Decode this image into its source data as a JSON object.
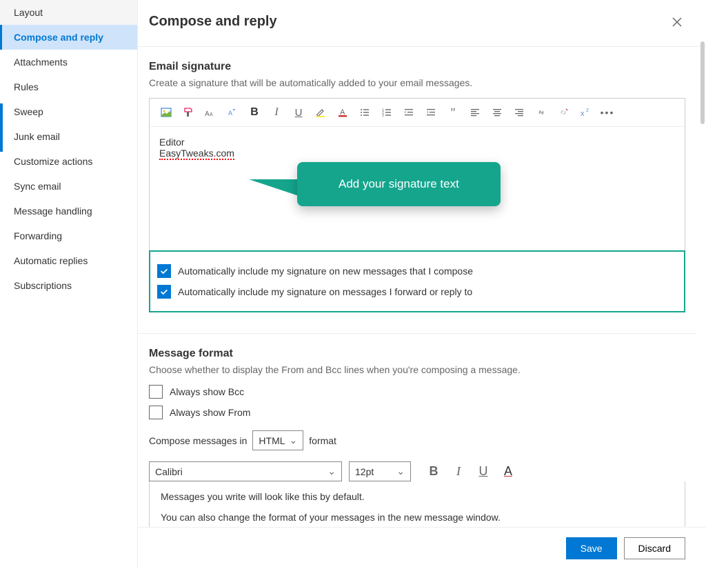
{
  "sidebar": {
    "items": [
      {
        "label": "Layout"
      },
      {
        "label": "Compose and reply"
      },
      {
        "label": "Attachments"
      },
      {
        "label": "Rules"
      },
      {
        "label": "Sweep"
      },
      {
        "label": "Junk email"
      },
      {
        "label": "Customize actions"
      },
      {
        "label": "Sync email"
      },
      {
        "label": "Message handling"
      },
      {
        "label": "Forwarding"
      },
      {
        "label": "Automatic replies"
      },
      {
        "label": "Subscriptions"
      }
    ],
    "active_index": 1
  },
  "header": {
    "title": "Compose and reply"
  },
  "signature": {
    "title": "Email signature",
    "desc": "Create a signature that will be automatically added to your email messages.",
    "editor_line1": "Editor",
    "editor_line2": "EasyTweaks.com",
    "callout": "Add your signature text",
    "check_new": "Automatically include my signature on new messages that I compose",
    "check_reply": "Automatically include my signature on messages I forward or reply to",
    "check_new_on": true,
    "check_reply_on": true
  },
  "message_format": {
    "title": "Message format",
    "desc": "Choose whether to display the From and Bcc lines when you're composing a message.",
    "show_bcc": "Always show Bcc",
    "show_from": "Always show From",
    "compose_in_pre": "Compose messages in",
    "compose_in_value": "HTML",
    "compose_in_post": "format",
    "font": "Calibri",
    "size": "12pt",
    "preview1": "Messages you write will look like this by default.",
    "preview2": "You can also change the format of your messages in the new message window."
  },
  "footer": {
    "save": "Save",
    "discard": "Discard"
  }
}
